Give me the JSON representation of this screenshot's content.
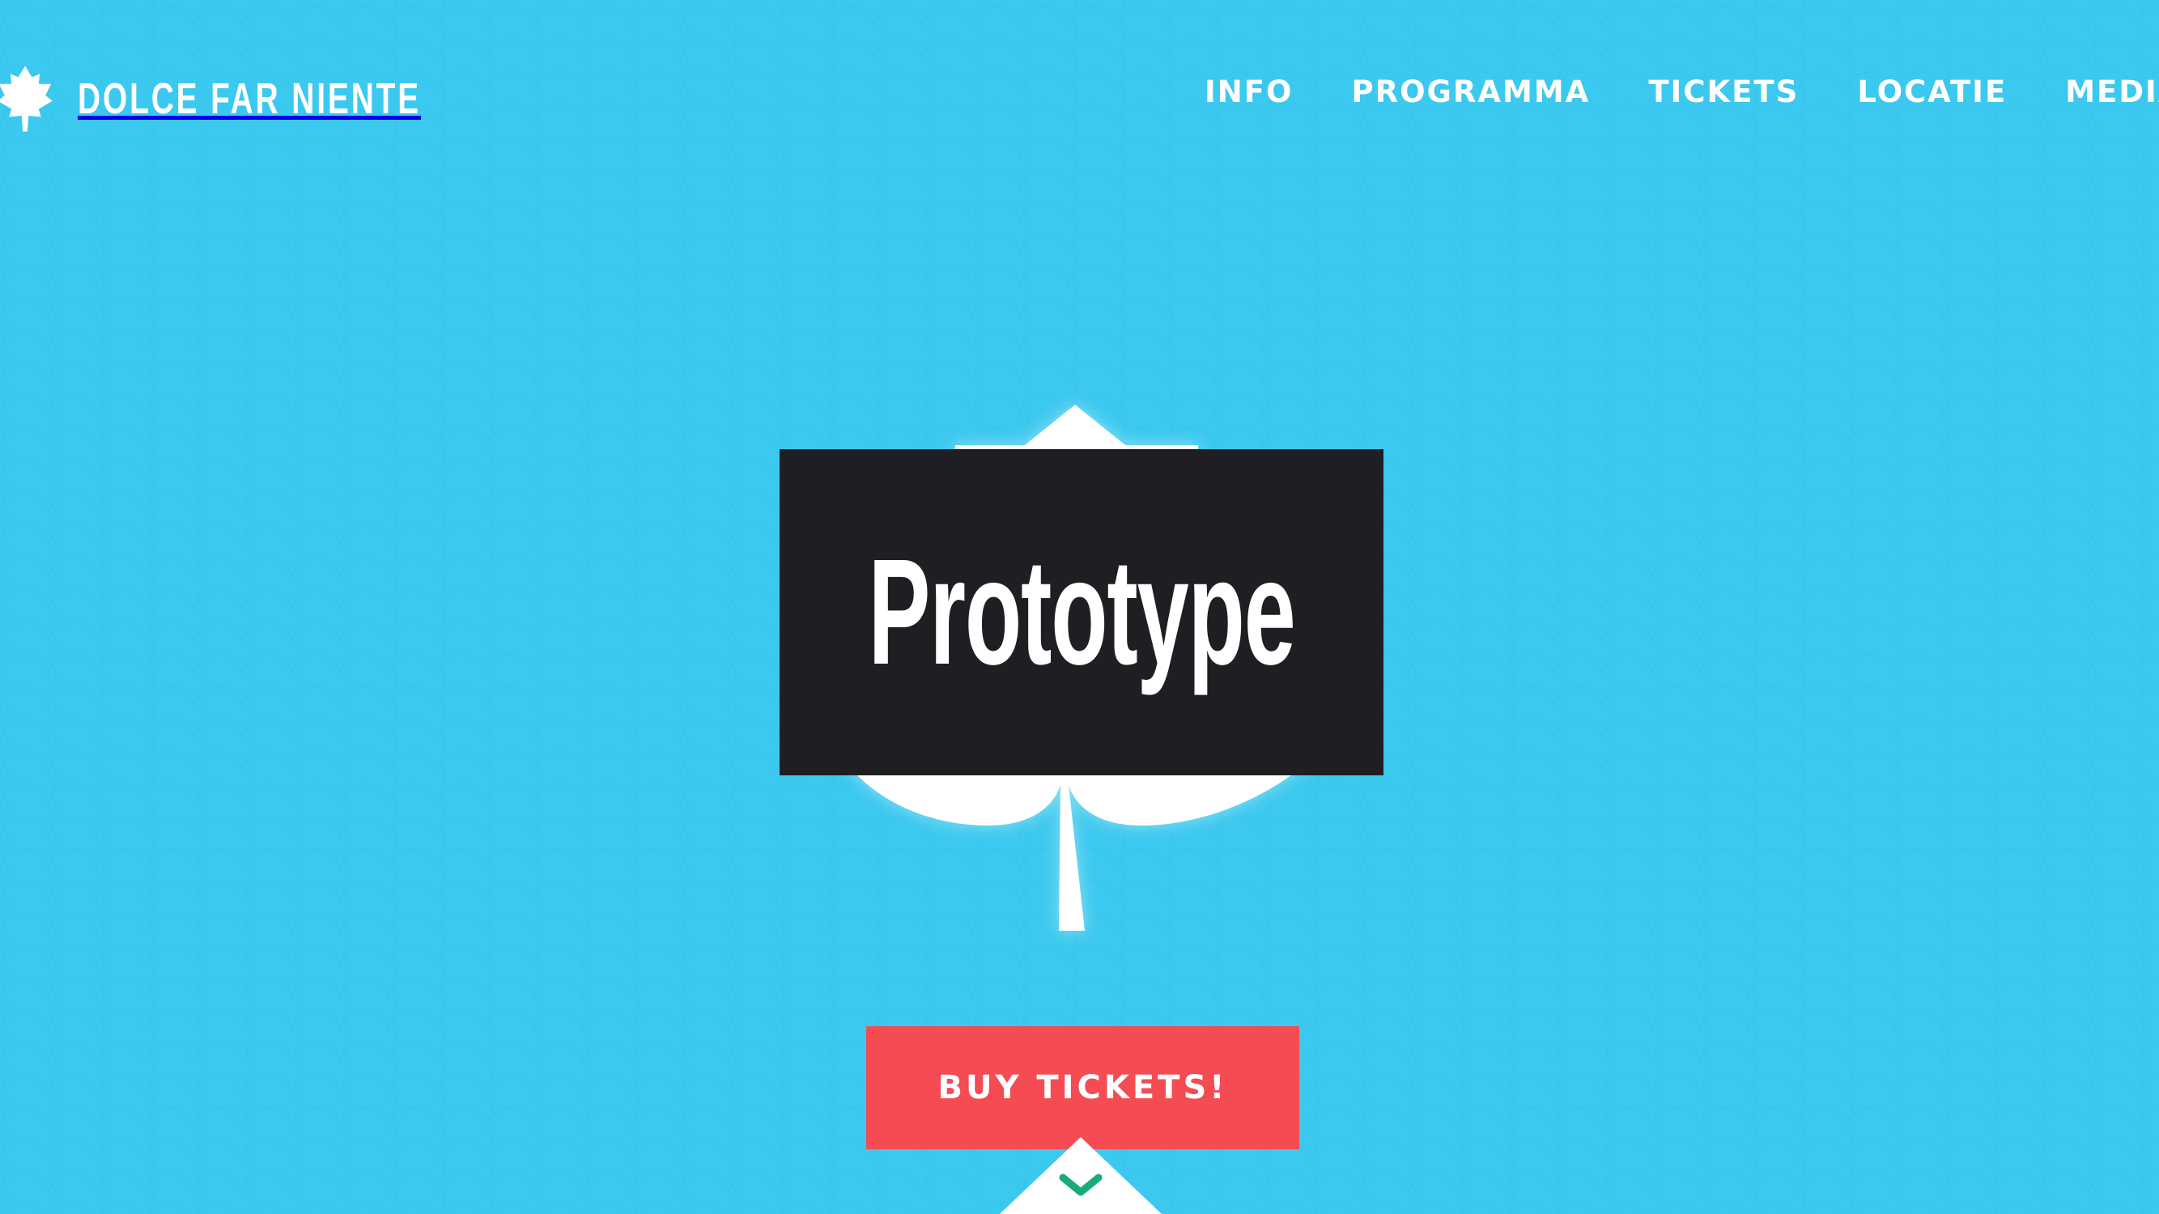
{
  "header": {
    "logo_text": "DOLCE FAR NIENTE",
    "logo_icon": "maple-leaf-icon",
    "nav": [
      {
        "label": "INFO"
      },
      {
        "label": "PROGRAMMA"
      },
      {
        "label": "TICKETS"
      },
      {
        "label": "LOCATIE"
      },
      {
        "label": "MEDIA"
      }
    ]
  },
  "hero": {
    "overlay_label": "Prototype",
    "cta_label": "BUY TICKETS!",
    "scroll_icon": "chevron-down-icon"
  },
  "colors": {
    "background": "#3cc9ef",
    "overlay": "#1f1e22",
    "cta": "#f54b53",
    "chevron": "#1aab7a",
    "text": "#ffffff"
  }
}
